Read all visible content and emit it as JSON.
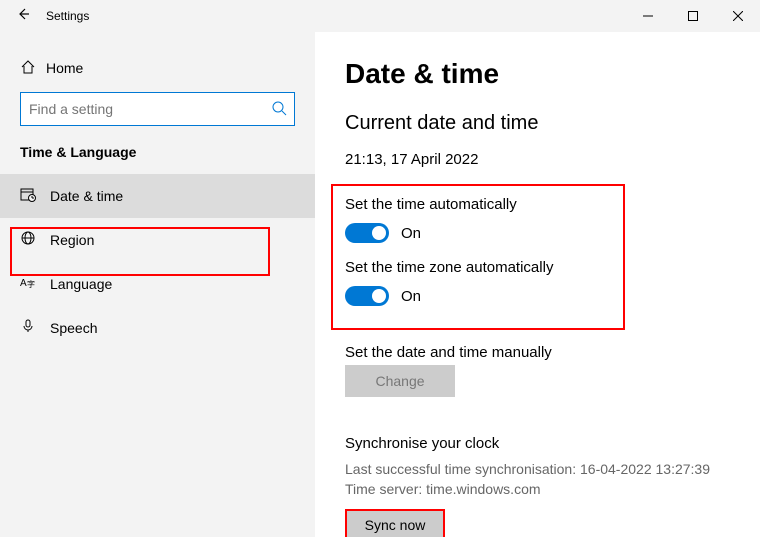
{
  "titlebar": {
    "title": "Settings"
  },
  "sidebar": {
    "home": "Home",
    "search_placeholder": "Find a setting",
    "group": "Time & Language",
    "items": [
      {
        "label": "Date & time"
      },
      {
        "label": "Region"
      },
      {
        "label": "Language"
      },
      {
        "label": "Speech"
      }
    ]
  },
  "content": {
    "heading": "Date & time",
    "subheading": "Current date and time",
    "datetime": "21:13, 17 April 2022",
    "auto_time_label": "Set the time automatically",
    "auto_time_state": "On",
    "auto_tz_label": "Set the time zone automatically",
    "auto_tz_state": "On",
    "manual_label": "Set the date and time manually",
    "change_btn": "Change",
    "sync_heading": "Synchronise your clock",
    "sync_last": "Last successful time synchronisation: 16-04-2022 13:27:39",
    "sync_server": "Time server: time.windows.com",
    "sync_btn": "Sync now"
  }
}
